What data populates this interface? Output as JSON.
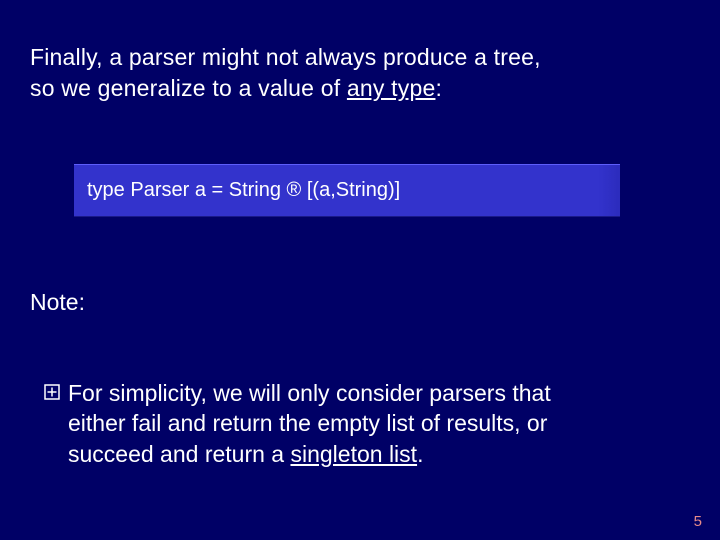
{
  "intro": {
    "line1_a": "Finally, a parser might not always produce a tree,",
    "line2_a": "so we generalize to a value of ",
    "line2_underlined": "any type",
    "line2_after": ":"
  },
  "code": {
    "prefix": "type Parser a = String ",
    "arrow": "®",
    "suffix": " [(a,String)]"
  },
  "note_label": "Note:",
  "bullet1": {
    "a": "For simplicity, we will only consider parsers that",
    "b": "either fail and return the empty list of results, or",
    "c": "succeed and return a ",
    "c_underlined": "singleton list",
    "c_after": "."
  },
  "page_number": "5"
}
